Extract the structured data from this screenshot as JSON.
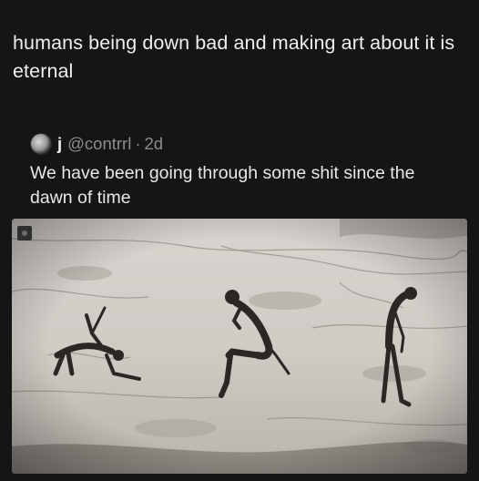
{
  "post": {
    "text": "humans being down bad and making art about it is eternal"
  },
  "quoted_post": {
    "display_name": "j",
    "handle": "@contrrl",
    "separator": "·",
    "time_ago": "2d",
    "text": "We have been going through some shit since the dawn of time"
  },
  "media": {
    "icon": "image-badge-icon",
    "description_icons": [
      "cave-painting-figure-bent",
      "cave-painting-figure-sitting",
      "cave-painting-figure-standing"
    ]
  }
}
